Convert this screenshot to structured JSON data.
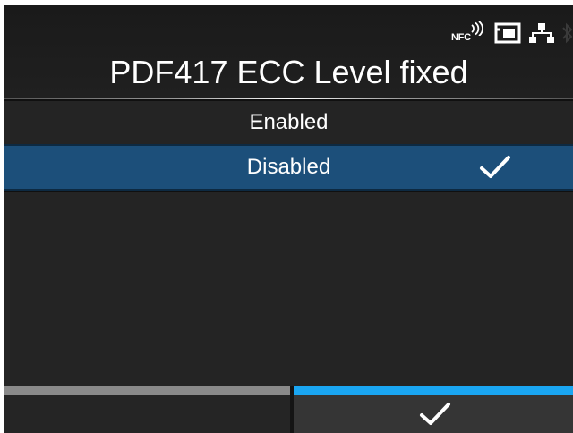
{
  "colors": {
    "background": "#242424",
    "selected_item": "#1c4f7a",
    "confirm_bar": "#1aa6f2",
    "back_bar": "#8a8a8a",
    "text": "#ffffff"
  },
  "status_bar": {
    "nfc_label": "NFC",
    "icons": [
      "nfc-icon",
      "sd-card-icon",
      "network-icon",
      "bluetooth-icon"
    ]
  },
  "header": {
    "title": "PDF417 ECC Level fixed"
  },
  "options": [
    {
      "label": "Enabled",
      "selected": false
    },
    {
      "label": "Disabled",
      "selected": true,
      "icon": "checkmark-icon"
    }
  ],
  "softkeys": {
    "left": {
      "label": ""
    },
    "right": {
      "icon": "checkmark-icon"
    }
  }
}
